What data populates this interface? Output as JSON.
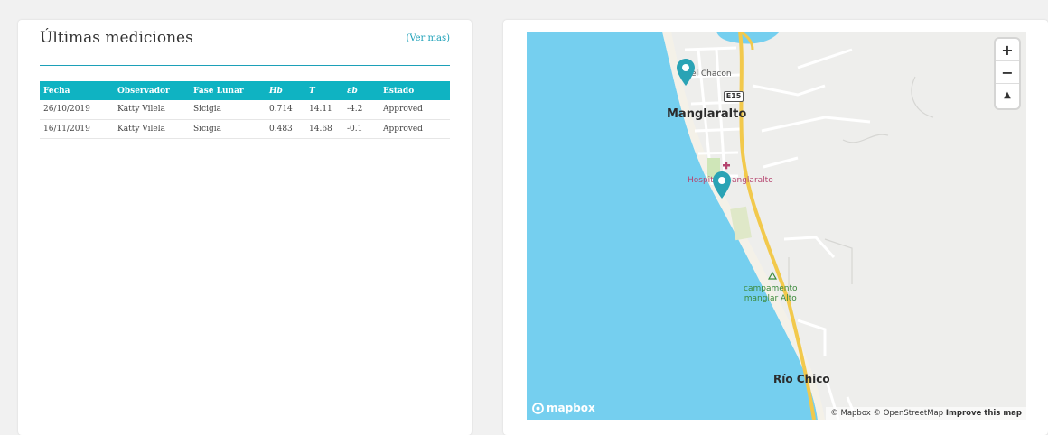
{
  "measurements": {
    "title": "Últimas mediciones",
    "see_more": "(Ver mas)",
    "columns": [
      "Fecha",
      "Observador",
      "Fase Lunar",
      "Hb",
      "T",
      "εb",
      "Estado"
    ],
    "rows": [
      {
        "fecha": "26/10/2019",
        "observador": "Katty Vilela",
        "fase": "Sicigia",
        "hb": "0.714",
        "t": "14.11",
        "eb": "-4.2",
        "estado": "Approved"
      },
      {
        "fecha": "16/11/2019",
        "observador": "Katty Vilela",
        "fase": "Sicigia",
        "hb": "0.483",
        "t": "14.68",
        "eb": "-0.1",
        "estado": "Approved"
      }
    ]
  },
  "map": {
    "labels": {
      "chacon": "el Chacon",
      "route": "E15",
      "town": "Manglaralto",
      "hospital_left": "Hospit",
      "hospital_right": "anglaralto",
      "camp_line1": "campamento",
      "camp_line2": "manglar Alto",
      "rio": "Río Chico"
    },
    "controls": {
      "zoom_in": "+",
      "zoom_out": "−",
      "compass": "▲"
    },
    "logo": "mapbox",
    "attribution": {
      "copyright": "© Mapbox © OpenStreetMap",
      "improve": "Improve this map"
    },
    "colors": {
      "water": "#75cfef",
      "land": "#eeeeec",
      "highway": "#f2c94c",
      "pin": "#2aa3b5",
      "park": "#cfe6b8"
    }
  }
}
